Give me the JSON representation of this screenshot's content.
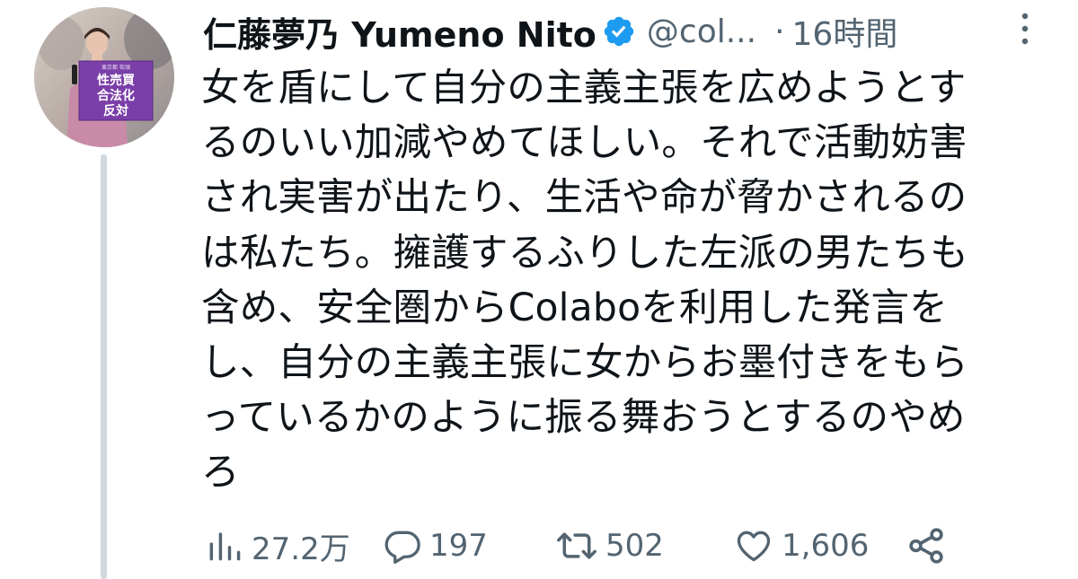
{
  "author": {
    "display_name": "仁藤夢乃 Yumeno Nito",
    "handle": "@col...",
    "separator": "·",
    "timestamp": "16時間",
    "avatar_sign_lines": [
      "性売買",
      "合法化",
      "反対"
    ],
    "avatar_sign_caption": "東京都 街頭"
  },
  "tweet": {
    "text": "女を盾にして自分の主義主張を広めようとす\nるのいい加減やめてほしい。それで活動妨害\nされ実害が出たり、生活や命が脅かされるの\nは私たち。擁護するふりした左派の男たちも\n含め、安全圏からColaboを利用した発言を\nし、自分の主義主張に女からお墨付きをもら\nっているかのように振る舞おうとするのやめ\nろ"
  },
  "actions": {
    "views": "27.2万",
    "replies": "197",
    "retweets": "502",
    "likes": "1,606"
  },
  "colors": {
    "text": "#0f1419",
    "secondary": "#536471",
    "verified": "#1d9bf0",
    "thread_line": "#cfd9de",
    "sign": "#7a3fa8"
  },
  "icons": {
    "verified": "verified-badge-icon",
    "more": "more-vertical-icon",
    "views": "analytics-icon",
    "reply": "reply-icon",
    "retweet": "retweet-icon",
    "like": "heart-icon",
    "share": "share-icon"
  }
}
